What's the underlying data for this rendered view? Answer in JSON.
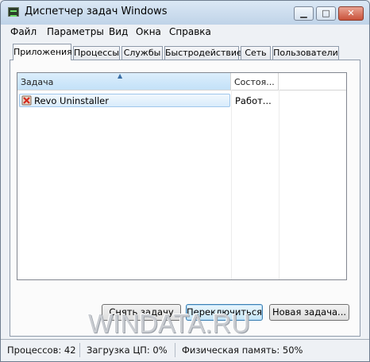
{
  "window": {
    "title": "Диспетчер задач Windows",
    "minimize_label": "▁",
    "maximize_label": "□",
    "close_label": "✕"
  },
  "menu": [
    "Файл",
    "Параметры",
    "Вид",
    "Окна",
    "Справка"
  ],
  "tabs": [
    "Приложения",
    "Процессы",
    "Службы",
    "Быстродействие",
    "Сеть",
    "Пользователи"
  ],
  "active_tab": "Приложения",
  "table": {
    "columns": [
      "Задача",
      "Состоя..."
    ],
    "sort_indicator": "▲",
    "rows": [
      {
        "task": "Revo Uninstaller",
        "status": "Работ...",
        "icon": "revo-uninstaller-icon"
      }
    ]
  },
  "buttons": {
    "end_task": "Снять задачу",
    "switch_to": "Переключиться",
    "new_task": "Новая задача..."
  },
  "watermark": "WINDATA.RU",
  "status": {
    "processes": "Процессов: 42",
    "cpu": "Загрузка ЦП: 0%",
    "memory": "Физическая память: 50%"
  }
}
